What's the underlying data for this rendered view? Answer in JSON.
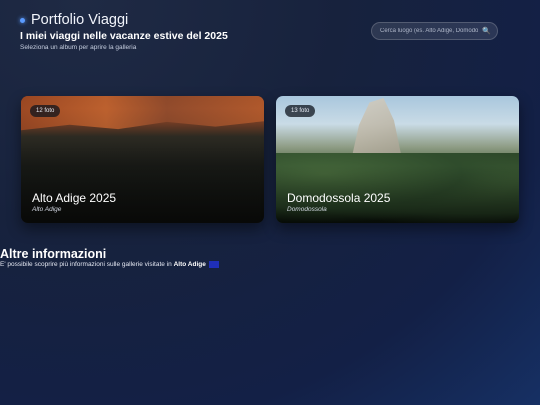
{
  "header": {
    "brand": "Portfolio Viaggi",
    "subtitle": "I miei viaggi nelle vacanze estive del 2025",
    "hint": "Seleziona un album per aprire la galleria"
  },
  "search": {
    "placeholder": "Cerca luogo (es. Alto Adige, Domodossola)",
    "icon": "search-icon"
  },
  "albums": [
    {
      "badge": "12 foto",
      "title": "Alto Adige 2025",
      "location": "Alto Adige"
    },
    {
      "badge": "13 foto",
      "title": "Domodossola 2025",
      "location": "Domodossola"
    }
  ],
  "info": {
    "title": "Altre informazioni",
    "text": "E' possibile scoprire più informazioni sulle gallerie visitate in",
    "highlight": "Alto Adige"
  },
  "colors": {
    "accent": "#5b9bff",
    "background": "#17223d"
  }
}
